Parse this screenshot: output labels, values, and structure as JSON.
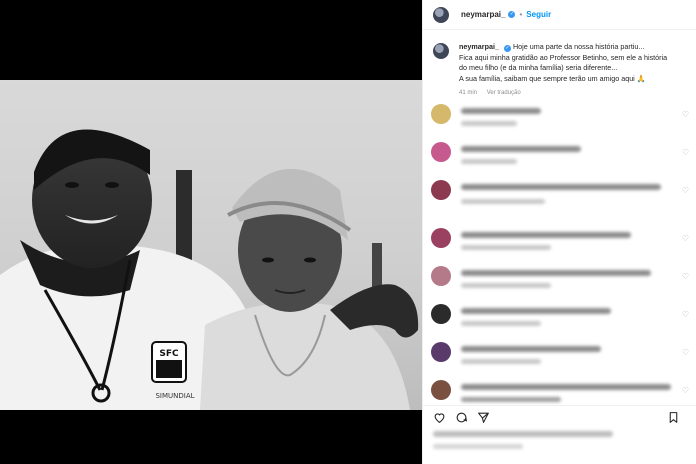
{
  "header": {
    "username": "neymarpai_",
    "separator": "•",
    "follow_label": "Seguir"
  },
  "caption": {
    "username": "neymarpai_",
    "line1": "Hoje uma parte da nossa história partiu...",
    "line2": "Fica aqui minha gratidão ao Professor Betinho, sem ele a história",
    "line3": "do meu filho (e da minha família) seria diferente...",
    "line4": "A sua família, saibam que sempre terão um amigo aqui 🙏",
    "time": "41 min",
    "translate_label": "Ver tradução"
  },
  "photo": {
    "shirt_text": "SIMUNDIAL",
    "crest_text": "SFC"
  },
  "icons": {
    "header_avatar": "avatar-icon",
    "verified": "verified-badge-icon",
    "like": "heart-icon",
    "comment": "comment-icon",
    "share": "paper-plane-icon",
    "save": "bookmark-icon"
  },
  "colors": {
    "accent": "#0095f6",
    "verified": "#3897f0"
  }
}
